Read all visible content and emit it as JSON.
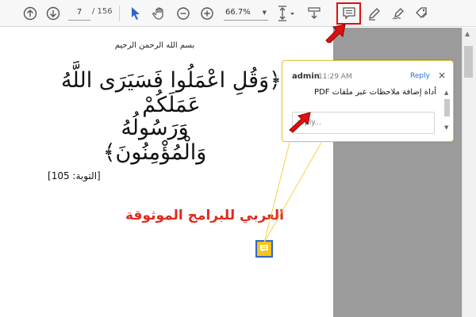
{
  "toolbar": {
    "page_current": "7",
    "page_total": "/ 156",
    "zoom": "66.7%",
    "icons": [
      "arrow-up-circle-icon",
      "arrow-down-circle-icon",
      "cursor-arrow-icon",
      "hand-icon",
      "zoom-out-icon",
      "zoom-in-icon",
      "fit-page-icon",
      "scroll-mode-icon",
      "comment-icon",
      "pen-icon",
      "signature-icon",
      "eraser-tag-icon"
    ]
  },
  "document": {
    "bismillah": "بسم الله الرحمن الرحيم",
    "verse_line1": "﴿وَقُلِ اعْمَلُوا فَسَيَرَى اللَّهُ عَمَلَكُمْ",
    "verse_line2": "وَرَسُولُهُ وَالْمُؤْمِنُونَ﴾",
    "reference": "[التوبة: 105]",
    "brand_text": "العربي للبرامج الموثوقة"
  },
  "comment": {
    "author": "admin",
    "time": "11:29 AM",
    "reply_link": "Reply",
    "close": "×",
    "text": "أداة إضافة ملاحظات عبر ملفات PDF",
    "reply_placeholder": "reply..."
  },
  "colors": {
    "accent_blue": "#2e66c7",
    "annotation_red": "#e01010",
    "brand_red": "#e02a1c",
    "note_yellow": "#f7c31a"
  }
}
